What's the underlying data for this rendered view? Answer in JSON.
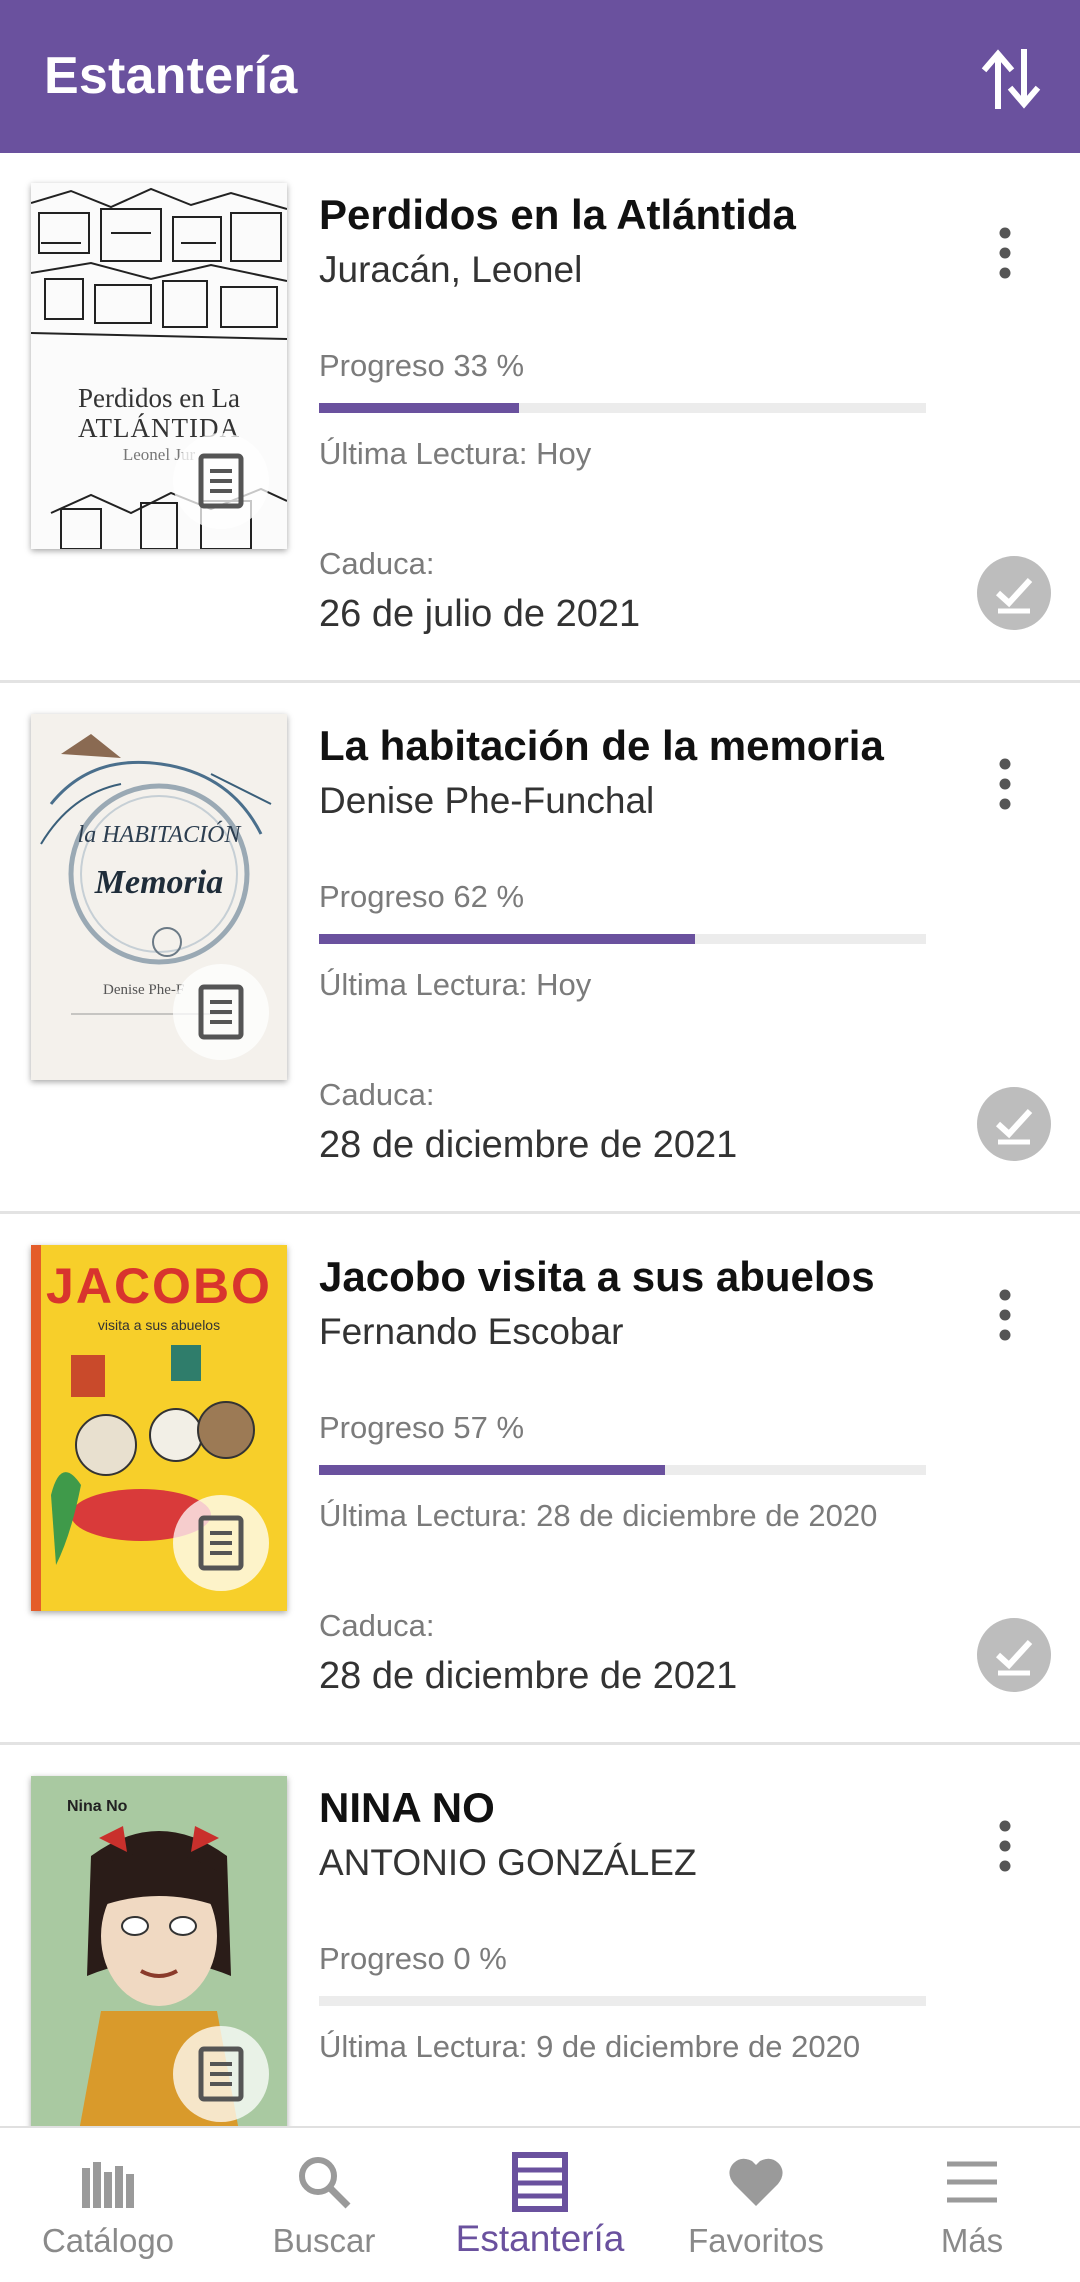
{
  "header": {
    "title": "Estantería",
    "sort_icon": "sort-arrows-icon"
  },
  "colors": {
    "primary": "#6a519e",
    "progress_track": "#ececec",
    "check_gray": "#bdbdbd"
  },
  "books": [
    {
      "title": "Perdidos en la Atlántida",
      "author": "Juracán, Leonel",
      "progress_label": "Progreso 33 %",
      "progress": 0.33,
      "last_read": "Última Lectura: Hoy",
      "expires_label": "Caduca:",
      "expires_date": "26 de julio de 2021",
      "cover_text": "Perdidos en La",
      "cover_text2": "ATLÁNTIDA",
      "cover_text3": "Leonel Jur"
    },
    {
      "title": "La habitación de la memoria",
      "author": "Denise Phe-Funchal",
      "progress_label": "Progreso 62 %",
      "progress": 0.62,
      "last_read": "Última Lectura: Hoy",
      "expires_label": "Caduca:",
      "expires_date": "28 de diciembre de 2021",
      "cover_text": "la HABITACIÓN",
      "cover_text2": "Memoria",
      "cover_text3": "Denise Phe-F"
    },
    {
      "title": "Jacobo visita a sus abuelos",
      "author": "Fernando Escobar",
      "progress_label": "Progreso 57 %",
      "progress": 0.57,
      "last_read": "Última Lectura: 28 de diciembre de 2020",
      "expires_label": "Caduca:",
      "expires_date": "28 de diciembre de 2021",
      "cover_text": "JACOBO",
      "cover_text2": "visita a sus abuelos"
    },
    {
      "title": "NINA NO",
      "author": "ANTONIO GONZÁLEZ",
      "progress_label": "Progreso 0 %",
      "progress": 0.0,
      "last_read": "Última Lectura: 9 de diciembre de 2020",
      "cover_text": "Nina No"
    }
  ],
  "bottom_nav": [
    {
      "label": "Catálogo",
      "icon": "catalog-icon"
    },
    {
      "label": "Buscar",
      "icon": "search-icon"
    },
    {
      "label": "Estantería",
      "icon": "shelf-icon",
      "active": true
    },
    {
      "label": "Favoritos",
      "icon": "heart-icon"
    },
    {
      "label": "Más",
      "icon": "menu-icon"
    }
  ]
}
